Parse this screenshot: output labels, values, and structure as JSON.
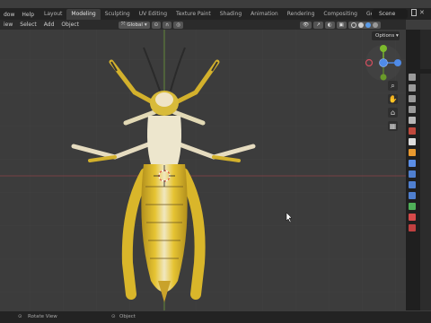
{
  "menu": [
    "dow",
    "Help"
  ],
  "tabs": [
    {
      "label": "Layout",
      "active": false
    },
    {
      "label": "Modeling",
      "active": true
    },
    {
      "label": "Sculpting",
      "active": false
    },
    {
      "label": "UV Editing",
      "active": false
    },
    {
      "label": "Texture Paint",
      "active": false
    },
    {
      "label": "Shading",
      "active": false
    },
    {
      "label": "Animation",
      "active": false
    },
    {
      "label": "Rendering",
      "active": false
    },
    {
      "label": "Compositing",
      "active": false
    },
    {
      "label": "Geometry N",
      "active": false
    }
  ],
  "scene": "Scene",
  "header": {
    "view": "iew",
    "select": "Select",
    "add": "Add",
    "object": "Object",
    "orientation": "Global"
  },
  "options_label": "Options",
  "status": {
    "left": "Rotate View",
    "right": "Object"
  },
  "colors": {
    "x_axis": "#d34f5f",
    "y_axis": "#7cba2c",
    "z_axis": "#4f8be8",
    "insect_body": "#d9b62a",
    "insect_belly": "#ece5c8"
  }
}
